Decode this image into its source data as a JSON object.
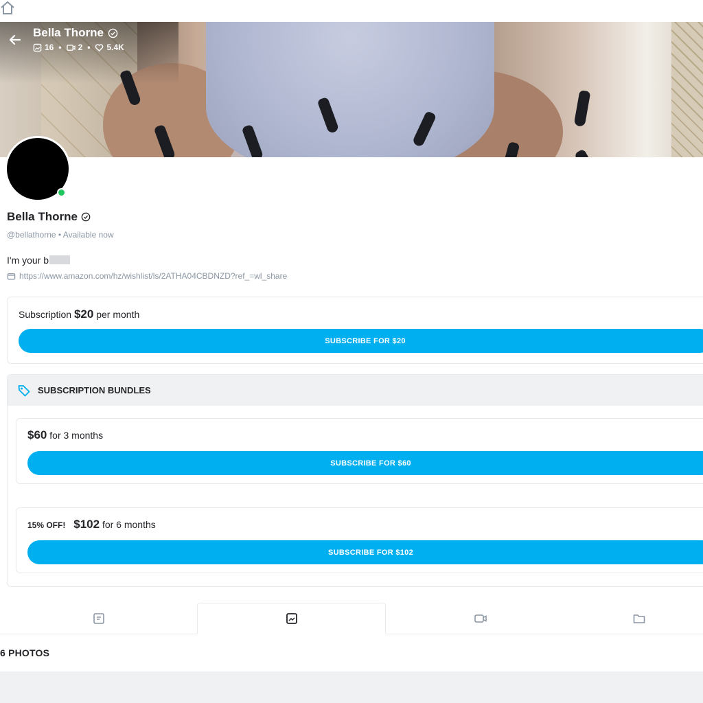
{
  "header": {
    "name": "Bella Thorne",
    "stats": {
      "photos": "16",
      "videos": "2",
      "likes": "5.4K"
    }
  },
  "profile": {
    "name": "Bella Thorne",
    "handle": "@bellathorne",
    "separator": "•",
    "availability": "Available now",
    "bio": "I'm your b",
    "link": "https://www.amazon.com/hz/wishlist/ls/2ATHA04CBDNZD?ref_=wl_share"
  },
  "subscription": {
    "label": "Subscription",
    "price": "$20",
    "period": "per month",
    "button": "SUBSCRIBE FOR $20"
  },
  "bundles": {
    "title": "SUBSCRIPTION BUNDLES",
    "items": [
      {
        "discount": "",
        "price": "$60",
        "period": "for 3 months",
        "button": "SUBSCRIBE FOR $60"
      },
      {
        "discount": "15% OFF!",
        "price": "$102",
        "period": "for 6 months",
        "button": "SUBSCRIBE FOR $102"
      }
    ]
  },
  "tabs": [
    {
      "icon": "posts-icon"
    },
    {
      "icon": "photos-icon",
      "active": true
    },
    {
      "icon": "videos-icon"
    },
    {
      "icon": "folders-icon"
    }
  ],
  "content": {
    "count_label": "6 PHOTOS"
  },
  "colors": {
    "accent": "#00aff0",
    "online": "#21c55d",
    "muted": "#8a96a3"
  }
}
